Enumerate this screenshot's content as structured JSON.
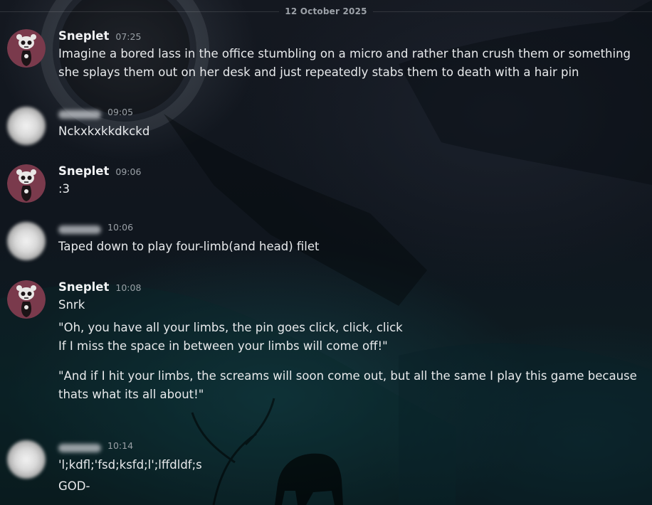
{
  "chat": {
    "date_divider": "12 October 2025",
    "messages": [
      {
        "author": "Sneplet",
        "author_hidden": false,
        "time": "07:25",
        "lines": [
          "Imagine a bored lass in the office stumbling on a micro and rather than crush them or something",
          "she splays them out on her desk and just repeatedly stabs them to death with a hair pin"
        ]
      },
      {
        "author": "",
        "author_hidden": true,
        "time": "09:05",
        "lines": [
          "Nckxkxkkdkckd"
        ]
      },
      {
        "author": "Sneplet",
        "author_hidden": false,
        "time": "09:06",
        "lines": [
          ":3"
        ]
      },
      {
        "author": "",
        "author_hidden": true,
        "time": "10:06",
        "lines": [
          "Taped down to play four-limb(and head) filet"
        ]
      },
      {
        "author": "Sneplet",
        "author_hidden": false,
        "time": "10:08",
        "lines": [
          "Snrk",
          "\"Oh, you have all your limbs, the pin goes click, click, click",
          "If I miss the space in between your limbs will come off!\"",
          "\"And if I hit your limbs, the screams will soon come out, but all the same I play this game because",
          "thats what its all about!\""
        ]
      },
      {
        "author": "",
        "author_hidden": true,
        "time": "10:14",
        "lines": [
          "'l;kdfl;'fsd;ksfd;l';lffdldf;s",
          "GOD-"
        ]
      }
    ]
  },
  "colors": {
    "avatar_bg": "#7a3a4c",
    "text": "#e8eaec",
    "timestamp": "#9aa0a6"
  },
  "icons": {
    "sneplet_avatar": "panda-skull-avatar-icon",
    "hidden_avatar": "blurred-avatar-icon"
  }
}
